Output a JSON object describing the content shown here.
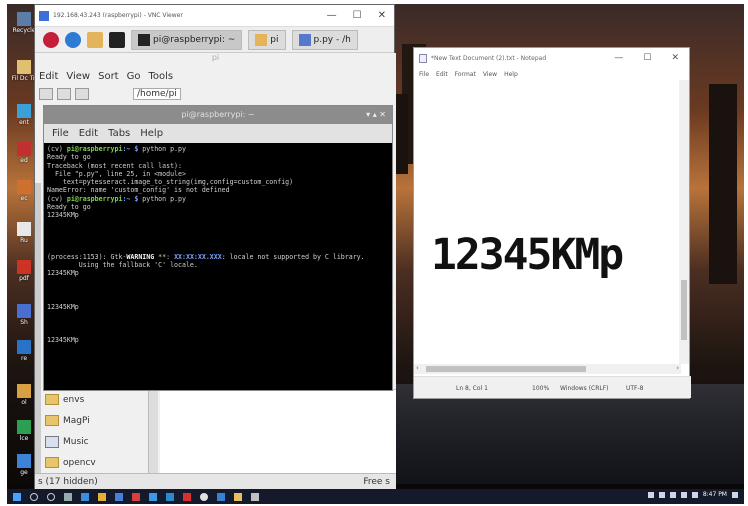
{
  "desktop": {
    "icons": [
      "Recycle",
      "Fil Dc Tu",
      "ent",
      "ed",
      "ec",
      "Ru",
      "pdf",
      "Sh",
      "re",
      "ol",
      "lce",
      "ge"
    ]
  },
  "vnc": {
    "title": "192.168.43.243 (raspberrypi) - VNC Viewer",
    "controls": [
      "—",
      "☐",
      "✕"
    ]
  },
  "pi_panel": {
    "tasks": [
      {
        "label": "pi@raspberrypi: ~"
      },
      {
        "label": "pi"
      },
      {
        "label": "p.py - /h"
      }
    ]
  },
  "file_manager": {
    "title": "pi",
    "menu": [
      "Edit",
      "View",
      "Sort",
      "Go",
      "Tools"
    ],
    "path": "/home/pi",
    "items": [
      {
        "label": "envs",
        "icon": "folder-icon"
      },
      {
        "label": "MagPi",
        "icon": "folder-icon"
      },
      {
        "label": "Music",
        "icon": "music-folder-icon"
      },
      {
        "label": "opencv",
        "icon": "folder-icon"
      }
    ],
    "status_left": "s (17 hidden)",
    "status_right": "Free s"
  },
  "terminal": {
    "title": "pi@raspberrypi: ~",
    "menu": [
      "File",
      "Edit",
      "Tabs",
      "Help"
    ],
    "lines": [
      {
        "segments": [
          {
            "t": "(cv) ",
            "c": ""
          },
          {
            "t": "pi@raspberrypi",
            "c": "g"
          },
          {
            "t": ":~ $ ",
            "c": "bl"
          },
          {
            "t": "python p.py",
            "c": ""
          }
        ]
      },
      {
        "segments": [
          {
            "t": "Ready to go",
            "c": ""
          }
        ]
      },
      {
        "segments": [
          {
            "t": "Traceback (most recent call last):",
            "c": ""
          }
        ]
      },
      {
        "segments": [
          {
            "t": "  File \"p.py\", line 25, in <module>",
            "c": ""
          }
        ]
      },
      {
        "segments": [
          {
            "t": "    text=pytesseract.image_to_string(img,config=custom_config)",
            "c": ""
          }
        ]
      },
      {
        "segments": [
          {
            "t": "NameError: name 'custom_config' is not defined",
            "c": ""
          }
        ]
      },
      {
        "segments": [
          {
            "t": "(cv) ",
            "c": ""
          },
          {
            "t": "pi@raspberrypi",
            "c": "g"
          },
          {
            "t": ":~ $ ",
            "c": "bl"
          },
          {
            "t": "python p.py",
            "c": ""
          }
        ]
      },
      {
        "segments": [
          {
            "t": "Ready to go",
            "c": ""
          }
        ]
      },
      {
        "segments": [
          {
            "t": "12345KMp",
            "c": ""
          }
        ]
      },
      {
        "segments": [
          {
            "t": "",
            "c": ""
          }
        ]
      },
      {
        "segments": [
          {
            "t": "",
            "c": ""
          }
        ]
      },
      {
        "segments": [
          {
            "t": "",
            "c": ""
          }
        ]
      },
      {
        "segments": [
          {
            "t": "",
            "c": ""
          }
        ]
      },
      {
        "segments": [
          {
            "t": "(process:1153): Gtk-",
            "c": ""
          },
          {
            "t": "WARNING",
            "c": "w"
          },
          {
            "t": " **: ",
            "c": ""
          },
          {
            "t": "XX:XX:XX.XXX",
            "c": "bl"
          },
          {
            "t": ": locale not supported by C library.",
            "c": ""
          }
        ]
      },
      {
        "segments": [
          {
            "t": "        Using the fallback 'C' locale.",
            "c": ""
          }
        ]
      },
      {
        "segments": [
          {
            "t": "12345KMp",
            "c": ""
          }
        ]
      },
      {
        "segments": [
          {
            "t": "",
            "c": ""
          }
        ]
      },
      {
        "segments": [
          {
            "t": "",
            "c": ""
          }
        ]
      },
      {
        "segments": [
          {
            "t": "",
            "c": ""
          }
        ]
      },
      {
        "segments": [
          {
            "t": "12345KMp",
            "c": ""
          }
        ]
      },
      {
        "segments": [
          {
            "t": "",
            "c": ""
          }
        ]
      },
      {
        "segments": [
          {
            "t": "",
            "c": ""
          }
        ]
      },
      {
        "segments": [
          {
            "t": "",
            "c": ""
          }
        ]
      },
      {
        "segments": [
          {
            "t": "12345KMp",
            "c": ""
          }
        ]
      }
    ]
  },
  "notepad": {
    "title": "*New Text Document (2).txt - Notepad",
    "menu": [
      "File",
      "Edit",
      "Format",
      "View",
      "Help"
    ],
    "content": "12345KMp",
    "status": {
      "position": "Ln 8, Col 1",
      "zoom": "100%",
      "line_ending": "Windows (CRLF)",
      "encoding": "UTF-8"
    }
  },
  "taskbar": {
    "clock": "8:47 PM"
  },
  "colors": {
    "terminal_bg": "#000000",
    "prompt_green": "#7fd24e",
    "prompt_blue": "#7aa2ff",
    "taskbar": "#141a2b"
  }
}
